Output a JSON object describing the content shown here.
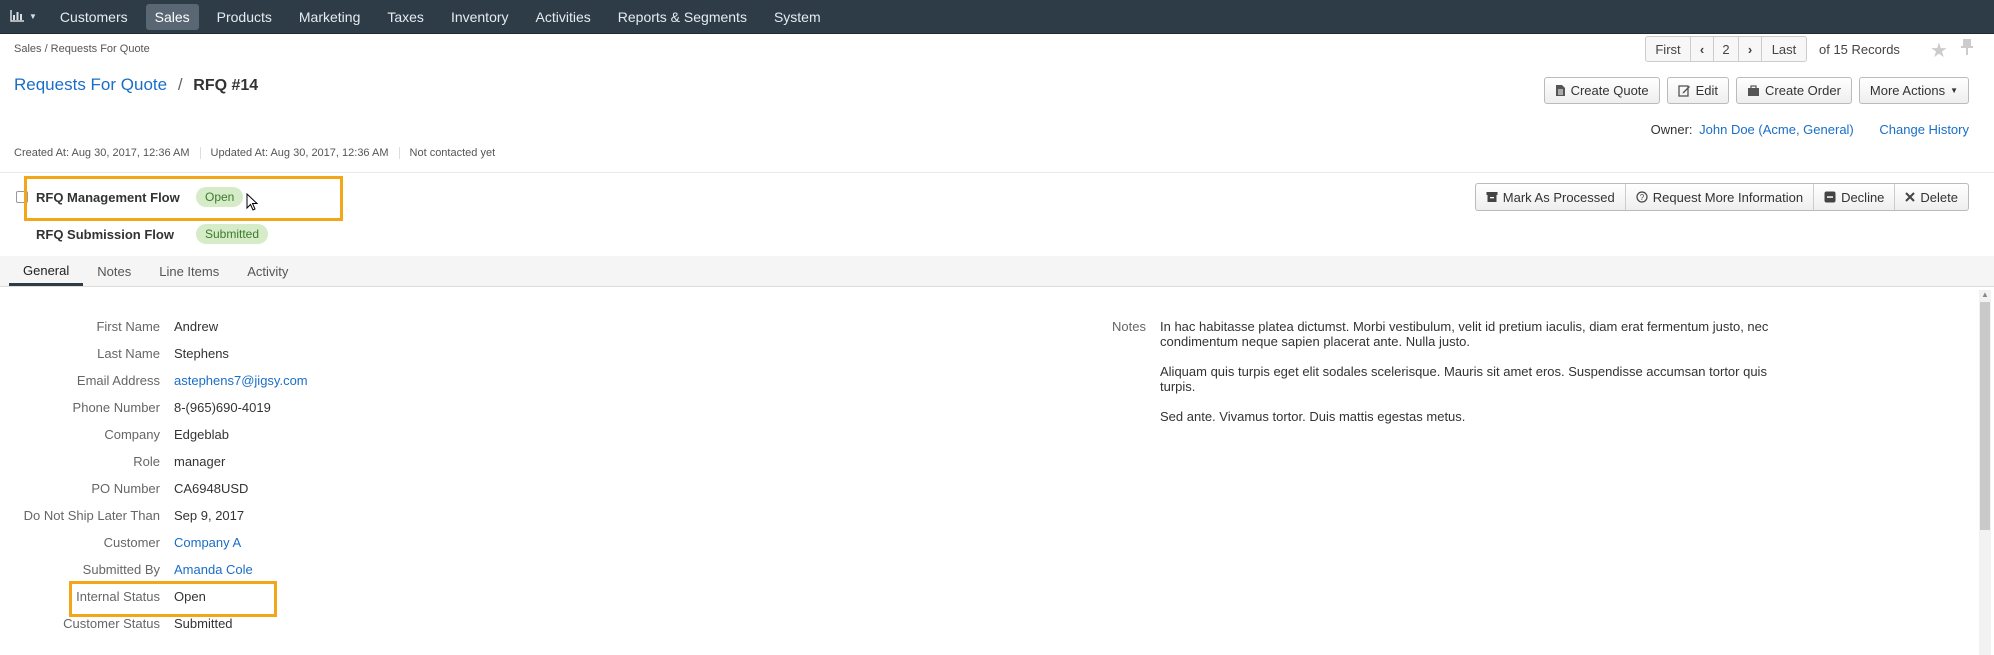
{
  "topnav": {
    "items": [
      "Customers",
      "Sales",
      "Products",
      "Marketing",
      "Taxes",
      "Inventory",
      "Activities",
      "Reports & Segments",
      "System"
    ],
    "active": "Sales"
  },
  "breadcrumb": "Sales / Requests For Quote",
  "pager": {
    "first": "First",
    "current": "2",
    "last": "Last",
    "of_text": "of 15 Records"
  },
  "title": {
    "link": "Requests For Quote",
    "separator": "/",
    "current": "RFQ #14"
  },
  "actions": {
    "create_quote": "Create Quote",
    "edit": "Edit",
    "create_order": "Create Order",
    "more_actions": "More Actions"
  },
  "owner": {
    "label": "Owner:",
    "value": "John Doe (Acme, General)",
    "change_history": "Change History"
  },
  "meta": {
    "created": "Created At: Aug 30, 2017, 12:36 AM",
    "updated": "Updated At: Aug 30, 2017, 12:36 AM",
    "contacted": "Not contacted yet"
  },
  "workflows": [
    {
      "name": "RFQ Management Flow",
      "status": "Open"
    },
    {
      "name": "RFQ Submission Flow",
      "status": "Submitted"
    }
  ],
  "workflow_actions": {
    "mark_processed": "Mark As Processed",
    "request_info": "Request More Information",
    "decline": "Decline",
    "delete": "Delete"
  },
  "tabs": [
    "General",
    "Notes",
    "Line Items",
    "Activity"
  ],
  "details": {
    "first_name": {
      "label": "First Name",
      "value": "Andrew"
    },
    "last_name": {
      "label": "Last Name",
      "value": "Stephens"
    },
    "email": {
      "label": "Email Address",
      "value": "astephens7@jigsy.com"
    },
    "phone": {
      "label": "Phone Number",
      "value": "8-(965)690-4019"
    },
    "company": {
      "label": "Company",
      "value": "Edgeblab"
    },
    "role": {
      "label": "Role",
      "value": "manager"
    },
    "po": {
      "label": "PO Number",
      "value": "CA6948USD"
    },
    "ship_date": {
      "label": "Do Not Ship Later Than",
      "value": "Sep 9, 2017"
    },
    "customer": {
      "label": "Customer",
      "value": "Company A"
    },
    "submitted_by": {
      "label": "Submitted By",
      "value": "Amanda Cole"
    },
    "internal_status": {
      "label": "Internal Status",
      "value": "Open"
    },
    "customer_status": {
      "label": "Customer Status",
      "value": "Submitted"
    }
  },
  "notes": {
    "label": "Notes",
    "paragraphs": [
      "In hac habitasse platea dictumst. Morbi vestibulum, velit id pretium iaculis, diam erat fermentum justo, nec condimentum neque sapien placerat ante. Nulla justo.",
      "Aliquam quis turpis eget elit sodales scelerisque. Mauris sit amet eros. Suspendisse accumsan tortor quis turpis.",
      "Sed ante. Vivamus tortor. Duis mattis egestas metus."
    ]
  },
  "colors": {
    "nav_bg": "#2e3c48",
    "link": "#1a6ec7",
    "highlight": "#f4a619",
    "badge_bg": "#d6ecc8"
  },
  "icons": [
    "dashboard-chart-icon",
    "chevron-left-icon",
    "chevron-right-icon",
    "star-icon",
    "pin-icon",
    "document-icon",
    "pencil-icon",
    "briefcase-icon",
    "archive-icon",
    "question-circle-icon",
    "minus-square-icon",
    "close-icon",
    "mouse-cursor-icon"
  ]
}
